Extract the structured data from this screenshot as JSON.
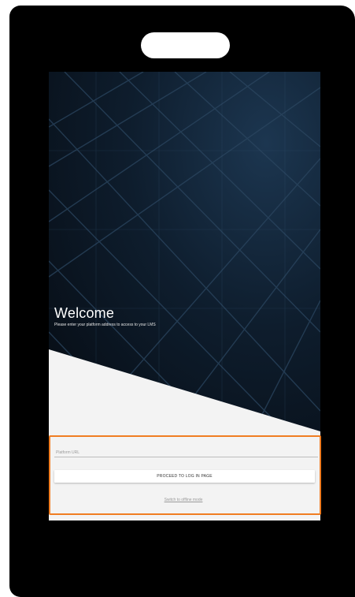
{
  "welcome": {
    "title": "Welcome",
    "subtitle": "Please enter your platform address to access to your LMS"
  },
  "form": {
    "url_placeholder": "Platform URL",
    "url_value": "",
    "proceed_label": "PROCEED TO LOG IN PAGE",
    "offline_link": "Switch to offline mode"
  },
  "colors": {
    "highlight_border": "#f07d22",
    "hero_dark": "#0e1d2d",
    "screen_background": "#f3f3f3"
  }
}
